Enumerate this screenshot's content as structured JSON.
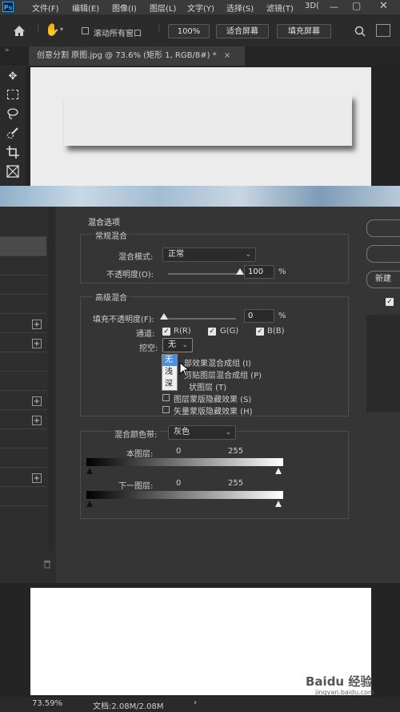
{
  "app": {
    "logo": "Ps"
  },
  "menu": [
    "文件(F)",
    "编辑(E)",
    "图像(I)",
    "图层(L)",
    "文字(Y)",
    "选择(S)",
    "滤镜(T)",
    "3D("
  ],
  "options_bar": {
    "scroll_all_windows": "滚动所有窗口",
    "zoom_btn": "100%",
    "fit_screen_btn": "适合屏幕",
    "fill_screen_btn": "填充屏幕"
  },
  "document_tab": {
    "title": "创意分割 原图.jpg @ 73.6% (矩形 1, RGB/8#) *",
    "close": "×"
  },
  "tools": [
    "move-tool-icon",
    "marquee-tool-icon",
    "lasso-tool-icon",
    "quick-select-tool-icon",
    "crop-tool-icon",
    "frame-tool-icon"
  ],
  "dialog": {
    "section_title": "混合选项",
    "general": {
      "title": "常规混合",
      "blend_mode_label": "混合模式:",
      "blend_mode_value": "正常",
      "opacity_label": "不透明度(O):",
      "opacity_value": "100",
      "opacity_unit": "%",
      "opacity_fraction": 1.0
    },
    "advanced": {
      "title": "高级混合",
      "fill_opacity_label": "填充不透明度(F):",
      "fill_opacity_value": "0",
      "fill_opacity_unit": "%",
      "fill_opacity_fraction": 0.0,
      "channels_label": "通道:",
      "channel_r": "R(R)",
      "channel_g": "G(G)",
      "channel_b": "B(B)",
      "knockout_label": "挖空:",
      "knockout_value": "无",
      "knockout_options": [
        "无",
        "浅",
        "深"
      ],
      "opt1": "将内部效果混合成组 (I)",
      "opt1_visible": "部效果混合成组 (I)",
      "opt2_visible": "剪贴图层混合成组 (P)",
      "opt3_visible": "状图层 (T)",
      "opt4": "图层蒙版隐藏效果 (S)",
      "opt5": "矢量蒙版隐藏效果 (H)"
    },
    "blend_if": {
      "label": "混合颜色带:",
      "value": "灰色",
      "this_layer_label": "本图层:",
      "this_layer_min": "0",
      "this_layer_max": "255",
      "underlying_label": "下一图层:",
      "underlying_min": "0",
      "underlying_max": "255"
    },
    "right_buttons": [
      "",
      "",
      "新建"
    ]
  },
  "status": {
    "zoom": "73.59%",
    "doc": "文档:2.08M/2.08M",
    "arrow": "›"
  },
  "watermark": {
    "brand": "Baidu 经验",
    "url": "jingyan.baidu.com"
  }
}
